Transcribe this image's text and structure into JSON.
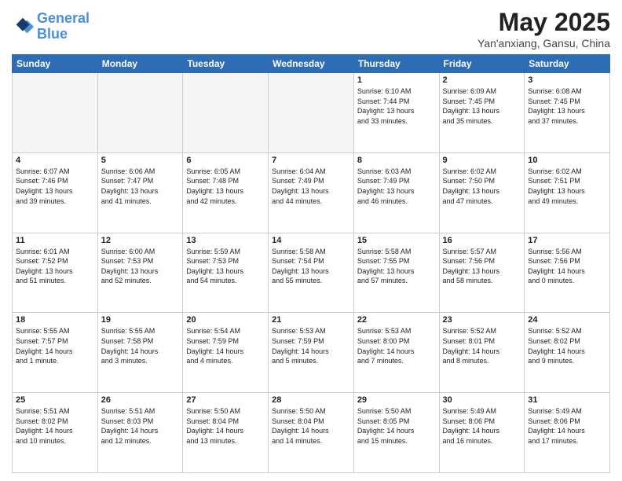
{
  "header": {
    "logo_line1": "General",
    "logo_line2": "Blue",
    "main_title": "May 2025",
    "subtitle": "Yan'anxiang, Gansu, China"
  },
  "weekdays": [
    "Sunday",
    "Monday",
    "Tuesday",
    "Wednesday",
    "Thursday",
    "Friday",
    "Saturday"
  ],
  "weeks": [
    [
      {
        "day": "",
        "info": ""
      },
      {
        "day": "",
        "info": ""
      },
      {
        "day": "",
        "info": ""
      },
      {
        "day": "",
        "info": ""
      },
      {
        "day": "1",
        "info": "Sunrise: 6:10 AM\nSunset: 7:44 PM\nDaylight: 13 hours\nand 33 minutes."
      },
      {
        "day": "2",
        "info": "Sunrise: 6:09 AM\nSunset: 7:45 PM\nDaylight: 13 hours\nand 35 minutes."
      },
      {
        "day": "3",
        "info": "Sunrise: 6:08 AM\nSunset: 7:45 PM\nDaylight: 13 hours\nand 37 minutes."
      }
    ],
    [
      {
        "day": "4",
        "info": "Sunrise: 6:07 AM\nSunset: 7:46 PM\nDaylight: 13 hours\nand 39 minutes."
      },
      {
        "day": "5",
        "info": "Sunrise: 6:06 AM\nSunset: 7:47 PM\nDaylight: 13 hours\nand 41 minutes."
      },
      {
        "day": "6",
        "info": "Sunrise: 6:05 AM\nSunset: 7:48 PM\nDaylight: 13 hours\nand 42 minutes."
      },
      {
        "day": "7",
        "info": "Sunrise: 6:04 AM\nSunset: 7:49 PM\nDaylight: 13 hours\nand 44 minutes."
      },
      {
        "day": "8",
        "info": "Sunrise: 6:03 AM\nSunset: 7:49 PM\nDaylight: 13 hours\nand 46 minutes."
      },
      {
        "day": "9",
        "info": "Sunrise: 6:02 AM\nSunset: 7:50 PM\nDaylight: 13 hours\nand 47 minutes."
      },
      {
        "day": "10",
        "info": "Sunrise: 6:02 AM\nSunset: 7:51 PM\nDaylight: 13 hours\nand 49 minutes."
      }
    ],
    [
      {
        "day": "11",
        "info": "Sunrise: 6:01 AM\nSunset: 7:52 PM\nDaylight: 13 hours\nand 51 minutes."
      },
      {
        "day": "12",
        "info": "Sunrise: 6:00 AM\nSunset: 7:53 PM\nDaylight: 13 hours\nand 52 minutes."
      },
      {
        "day": "13",
        "info": "Sunrise: 5:59 AM\nSunset: 7:53 PM\nDaylight: 13 hours\nand 54 minutes."
      },
      {
        "day": "14",
        "info": "Sunrise: 5:58 AM\nSunset: 7:54 PM\nDaylight: 13 hours\nand 55 minutes."
      },
      {
        "day": "15",
        "info": "Sunrise: 5:58 AM\nSunset: 7:55 PM\nDaylight: 13 hours\nand 57 minutes."
      },
      {
        "day": "16",
        "info": "Sunrise: 5:57 AM\nSunset: 7:56 PM\nDaylight: 13 hours\nand 58 minutes."
      },
      {
        "day": "17",
        "info": "Sunrise: 5:56 AM\nSunset: 7:56 PM\nDaylight: 14 hours\nand 0 minutes."
      }
    ],
    [
      {
        "day": "18",
        "info": "Sunrise: 5:55 AM\nSunset: 7:57 PM\nDaylight: 14 hours\nand 1 minute."
      },
      {
        "day": "19",
        "info": "Sunrise: 5:55 AM\nSunset: 7:58 PM\nDaylight: 14 hours\nand 3 minutes."
      },
      {
        "day": "20",
        "info": "Sunrise: 5:54 AM\nSunset: 7:59 PM\nDaylight: 14 hours\nand 4 minutes."
      },
      {
        "day": "21",
        "info": "Sunrise: 5:53 AM\nSunset: 7:59 PM\nDaylight: 14 hours\nand 5 minutes."
      },
      {
        "day": "22",
        "info": "Sunrise: 5:53 AM\nSunset: 8:00 PM\nDaylight: 14 hours\nand 7 minutes."
      },
      {
        "day": "23",
        "info": "Sunrise: 5:52 AM\nSunset: 8:01 PM\nDaylight: 14 hours\nand 8 minutes."
      },
      {
        "day": "24",
        "info": "Sunrise: 5:52 AM\nSunset: 8:02 PM\nDaylight: 14 hours\nand 9 minutes."
      }
    ],
    [
      {
        "day": "25",
        "info": "Sunrise: 5:51 AM\nSunset: 8:02 PM\nDaylight: 14 hours\nand 10 minutes."
      },
      {
        "day": "26",
        "info": "Sunrise: 5:51 AM\nSunset: 8:03 PM\nDaylight: 14 hours\nand 12 minutes."
      },
      {
        "day": "27",
        "info": "Sunrise: 5:50 AM\nSunset: 8:04 PM\nDaylight: 14 hours\nand 13 minutes."
      },
      {
        "day": "28",
        "info": "Sunrise: 5:50 AM\nSunset: 8:04 PM\nDaylight: 14 hours\nand 14 minutes."
      },
      {
        "day": "29",
        "info": "Sunrise: 5:50 AM\nSunset: 8:05 PM\nDaylight: 14 hours\nand 15 minutes."
      },
      {
        "day": "30",
        "info": "Sunrise: 5:49 AM\nSunset: 8:06 PM\nDaylight: 14 hours\nand 16 minutes."
      },
      {
        "day": "31",
        "info": "Sunrise: 5:49 AM\nSunset: 8:06 PM\nDaylight: 14 hours\nand 17 minutes."
      }
    ]
  ]
}
